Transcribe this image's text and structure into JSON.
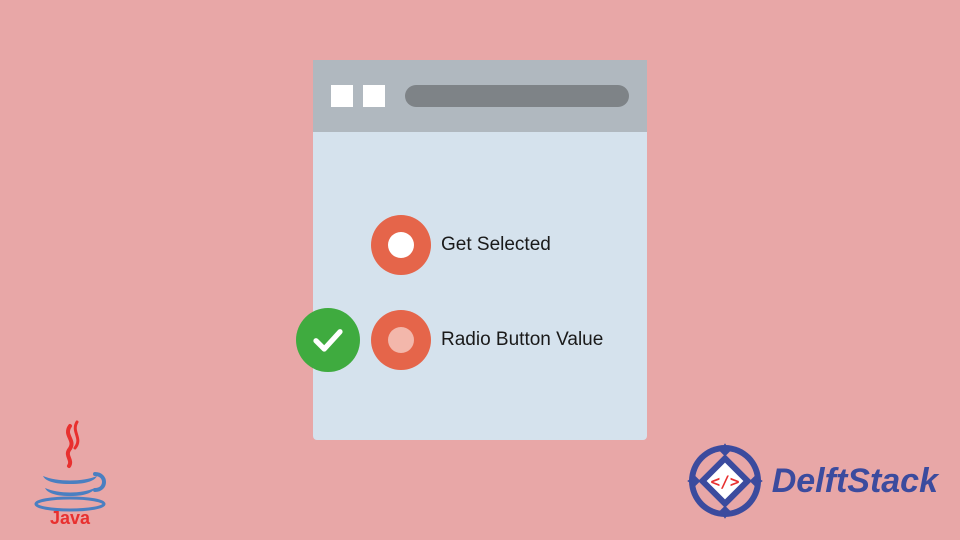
{
  "window": {
    "options": [
      {
        "label": "Get Selected",
        "selected": false
      },
      {
        "label": "Radio Button Value",
        "selected": true
      }
    ]
  },
  "logos": {
    "java_name": "Java",
    "brand_name": "DelftStack"
  },
  "icons": {
    "check": "check-icon",
    "radio": "radio-icon"
  },
  "colors": {
    "bg": "#e8a7a7",
    "window_body": "#d5e2ed",
    "titlebar": "#b0b8bf",
    "radio": "#e5654a",
    "check": "#3fab3f",
    "brand": "#3b4b9e"
  }
}
